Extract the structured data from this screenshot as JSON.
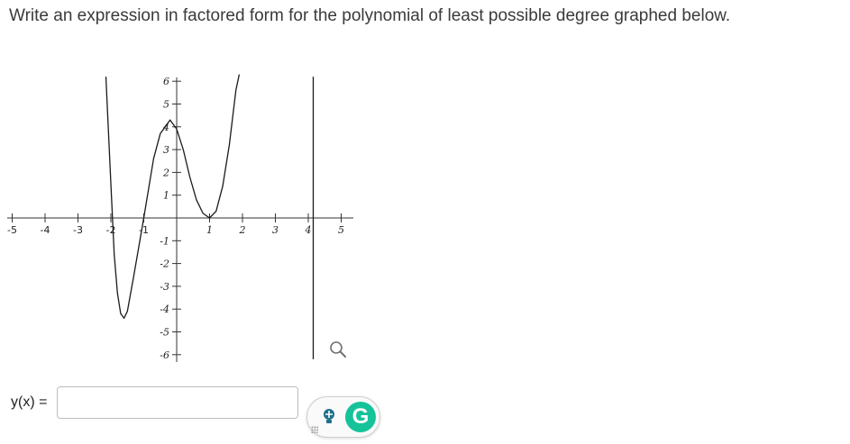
{
  "question": {
    "text": "Write an expression in factored form for the polynomial of least possible degree graphed below."
  },
  "graph": {
    "x_ticks": [
      "-5",
      "-4",
      "-3",
      "-2",
      "-1",
      "1",
      "2",
      "3",
      "4",
      "5"
    ],
    "y_ticks": [
      "6",
      "5",
      "4",
      "3",
      "2",
      "1",
      "-1",
      "-2",
      "-3",
      "-4",
      "-5",
      "-6"
    ],
    "zoom_icon": "zoom-magnifier-icon"
  },
  "chart_data": {
    "type": "line",
    "title": "",
    "xlabel": "",
    "ylabel": "",
    "xlim": [
      -5,
      5
    ],
    "ylim": [
      -6,
      6
    ],
    "grid": false,
    "series": [
      {
        "x": [
          -2.15,
          -2.0,
          -1.9,
          -1.8,
          -1.7,
          -1.6,
          -1.5,
          -1.3,
          -1.0,
          -0.7,
          -0.5,
          -0.2,
          0.0,
          0.2,
          0.4,
          0.6,
          0.8,
          1.0,
          1.2,
          1.4,
          1.6,
          1.8,
          1.9
        ],
        "y": [
          6.2,
          1.5,
          -1.6,
          -3.3,
          -4.2,
          -4.4,
          -4.1,
          -2.5,
          0.0,
          2.6,
          3.7,
          4.3,
          3.9,
          3.0,
          1.8,
          0.8,
          0.2,
          0.0,
          0.3,
          1.4,
          3.2,
          5.6,
          6.3
        ]
      },
      {
        "x": [
          4.15,
          4.15
        ],
        "y": [
          6.2,
          -6.2
        ]
      }
    ]
  },
  "answer": {
    "label": "y(x) =",
    "input_value": "",
    "input_placeholder": ""
  },
  "extension": {
    "hint_icon": "lightbulb-icon",
    "logo_letter": "G",
    "logo_icon": "grammarly-icon",
    "accent": "#15c39a"
  }
}
